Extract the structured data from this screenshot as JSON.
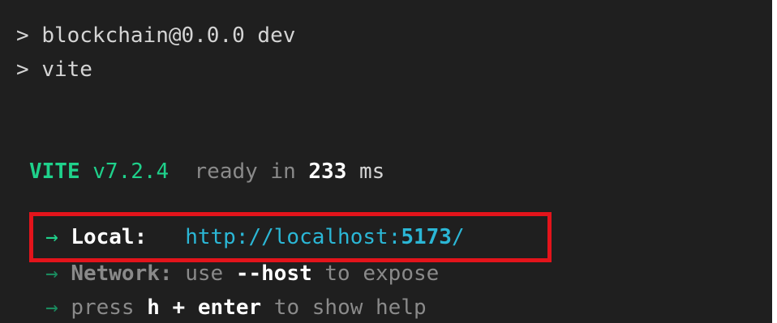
{
  "terminal": {
    "prompt_symbol": ">",
    "lines": {
      "npm_script": "blockchain@0.0.0 dev",
      "command": "vite"
    },
    "banner": {
      "name": "VITE",
      "version": "v7.2.4",
      "ready_text": "ready in",
      "time_value": "233",
      "time_unit": "ms"
    },
    "local": {
      "arrow": "→",
      "label": "Local:",
      "url_prefix": "http://localhost:",
      "url_port": "5173",
      "url_suffix": "/"
    },
    "network": {
      "arrow": "→",
      "label": "Network:",
      "text_use": "use",
      "flag": "--host",
      "text_expose": "to expose"
    },
    "help": {
      "arrow": "→",
      "text_press": "press",
      "key": "h + enter",
      "text_rest": "to show help"
    }
  },
  "colors": {
    "background": "#1f1f1f",
    "vite_green": "#1fd18b",
    "url_cyan": "#2bb7d6",
    "highlight_red": "#e3141b"
  }
}
